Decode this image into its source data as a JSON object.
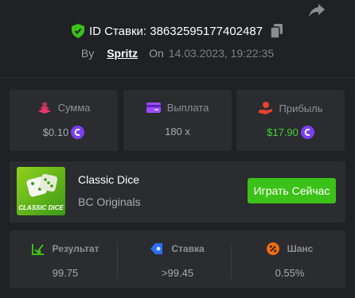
{
  "header": {
    "bet_id_label": "ID Ставки: 38632595177402487",
    "by_label": "By",
    "user": "Spritz",
    "on_label": "On",
    "date": "14.03.2023, 19:22:35"
  },
  "stats": [
    {
      "label": "Сумма",
      "value": "$0.10",
      "icon": "stack-coins-icon"
    },
    {
      "label": "Выплата",
      "value": "180 x",
      "icon": "payout-card-icon"
    },
    {
      "label": "Прибыль",
      "value": "$17.90",
      "icon": "hand-coin-icon"
    }
  ],
  "game": {
    "title": "Classic Dice",
    "subtitle": "BC Originals",
    "thumb_caption": "CLASSIC DICE",
    "play_label": "Играть Сейчас"
  },
  "results": [
    {
      "label": "Результат",
      "value": "99.75",
      "icon": "result-check-icon"
    },
    {
      "label": "Ставка",
      "value": ">99.45",
      "icon": "bet-tag-icon"
    },
    {
      "label": "Шанс",
      "value": "0.55%",
      "icon": "percent-icon"
    }
  ],
  "colors": {
    "background": "#1f2124",
    "card": "#2a2c30",
    "accent_green": "#3bc117",
    "profit_green": "#46d13a",
    "coin_purple": "#7b3ff2",
    "pink_icon": "#e8356d",
    "purple_icon": "#9b4dff",
    "red_icon": "#e8412f",
    "blue_icon": "#2b6cf0",
    "orange_icon": "#f06a12"
  }
}
